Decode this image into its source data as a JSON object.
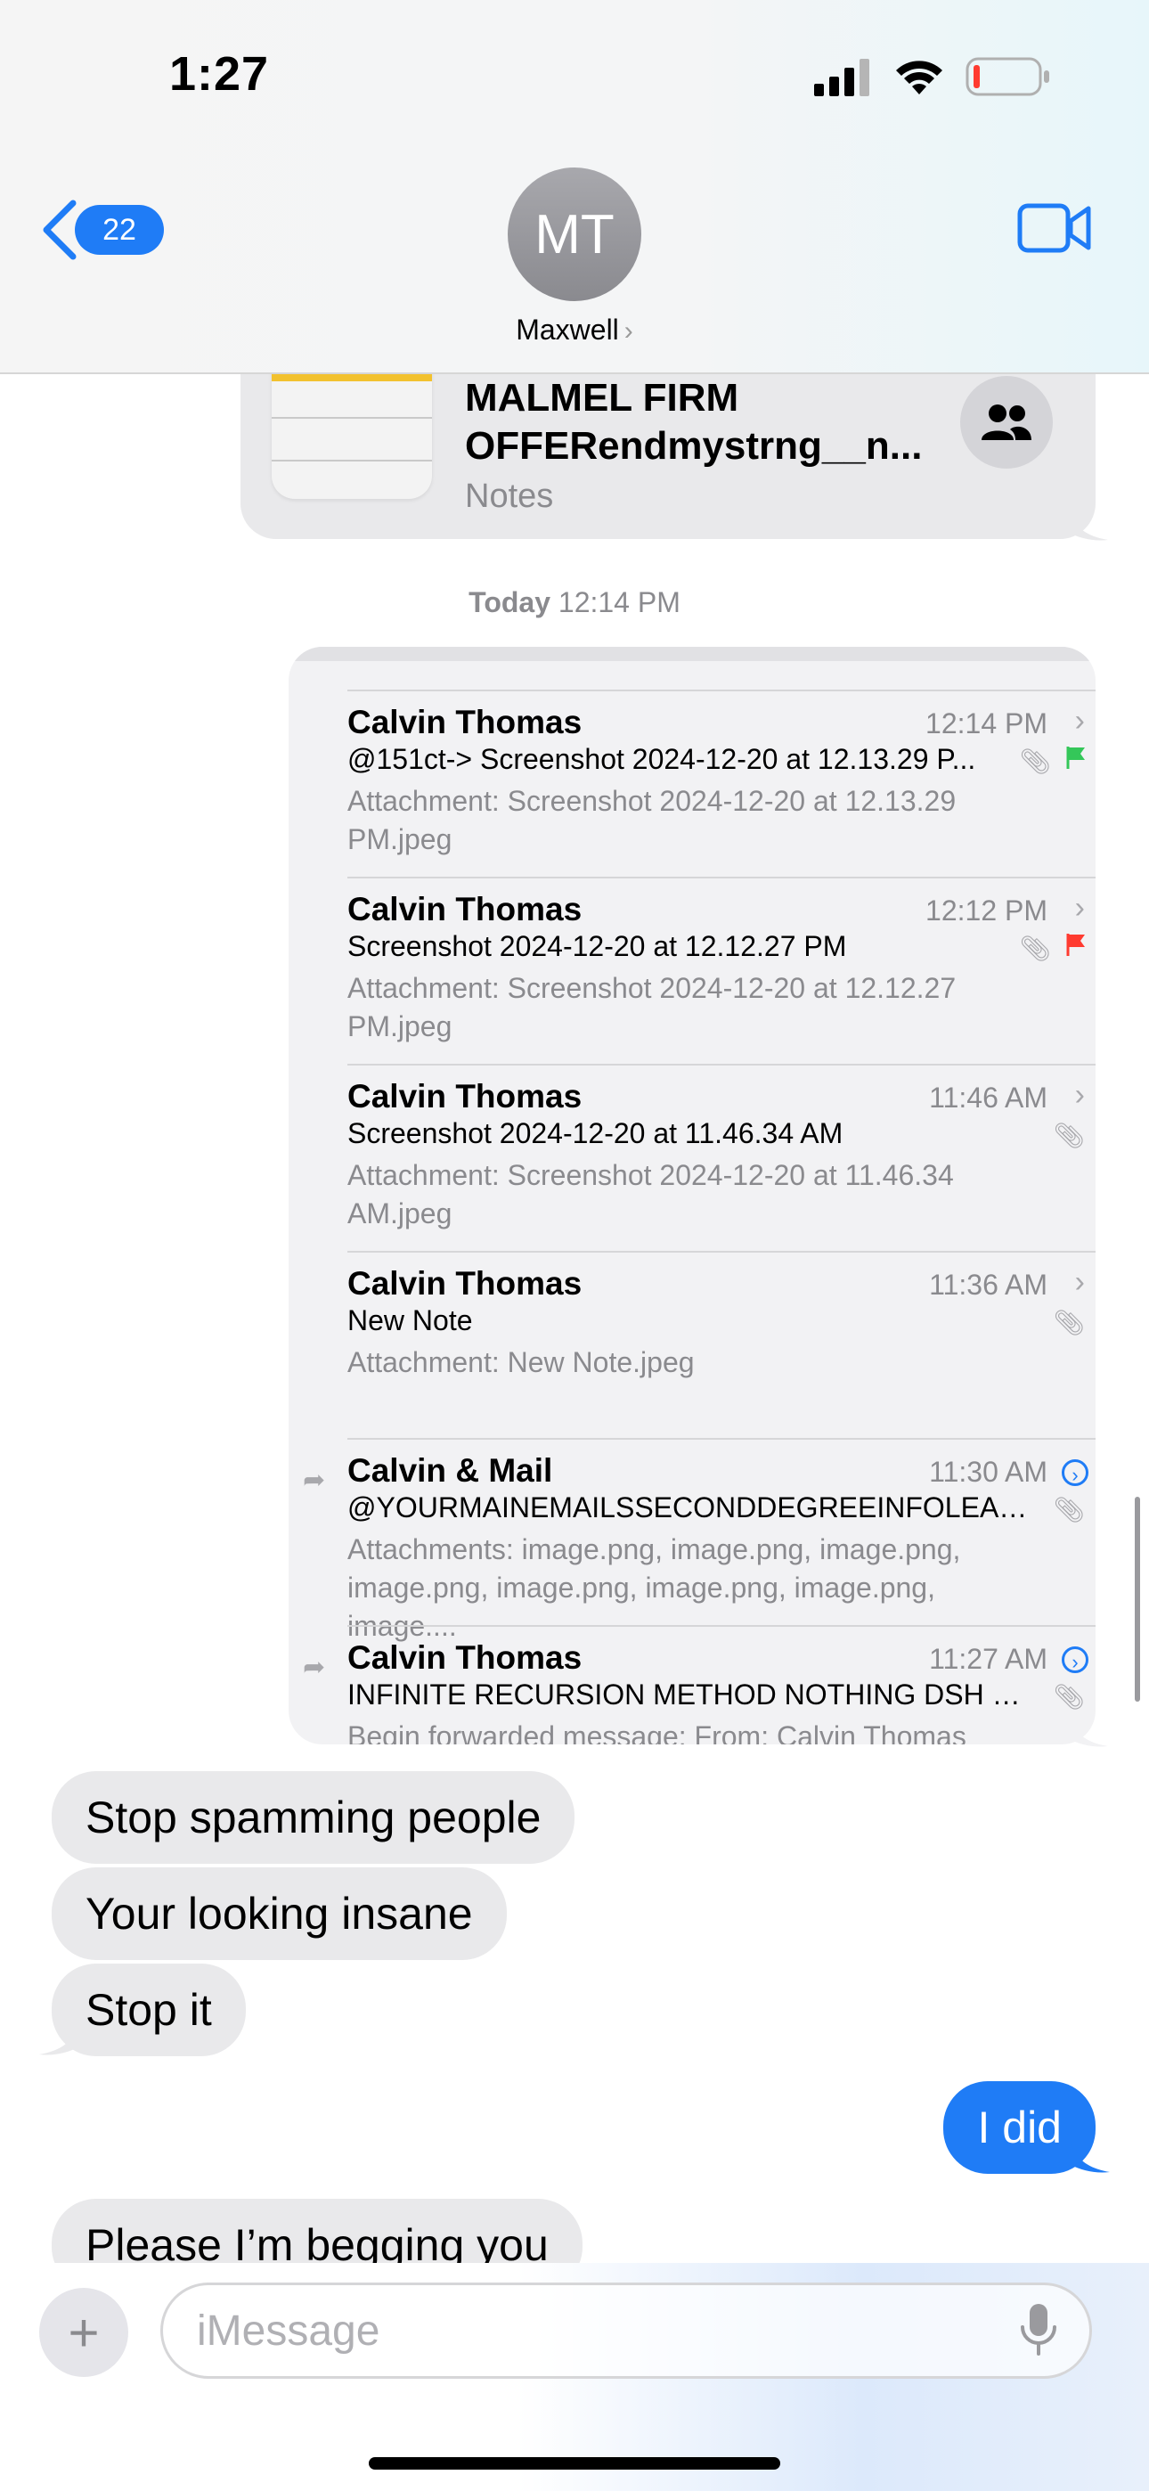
{
  "status_bar": {
    "time": "1:27"
  },
  "header": {
    "back_count": "22",
    "avatar_initials": "MT",
    "contact_name": "Maxwell"
  },
  "notes_card": {
    "title": "MALMEL FIRM OFFERendmystrng__n...",
    "app": "Notes"
  },
  "timestamp": {
    "day": "Today",
    "time": "12:14 PM"
  },
  "mail_items": [
    {
      "sender": "Calvin Thomas",
      "time": "12:14 PM",
      "subject": "@151ct-> Screenshot 2024-12-20 at 12.13.29 P...",
      "preview": "Attachment: Screenshot 2024-12-20 at 12.13.29 PM.jpeg",
      "flag_color": "#34c759"
    },
    {
      "sender": "Calvin Thomas",
      "time": "12:12 PM",
      "subject": "Screenshot 2024-12-20 at 12.12.27 PM",
      "preview": "Attachment: Screenshot 2024-12-20 at 12.12.27 PM.jpeg",
      "flag_color": "#ff3b30"
    },
    {
      "sender": "Calvin Thomas",
      "time": "11:46 AM",
      "subject": "Screenshot 2024-12-20 at 11.46.34 AM",
      "preview": "Attachment: Screenshot 2024-12-20 at 11.46.34 AM.jpeg"
    },
    {
      "sender": "Calvin Thomas",
      "time": "11:36 AM",
      "subject": "New Note",
      "preview": "Attachment: New Note.jpeg"
    },
    {
      "sender": "Calvin & Mail",
      "time": "11:30 AM",
      "subject": "@YOURMAINEMAILSSECONDDEGREEINFOLEAKR...",
      "preview": "Attachments: image.png, image.png, image.png, image.png, image.png, image.png, image.png, image...."
    },
    {
      "sender": "Calvin Thomas",
      "time": "11:27 AM",
      "subject": "INFINITE RECURSION METHOD NOTHING DSH EL...",
      "preview": "Begin forwarded message: From: Calvin Thomas"
    }
  ],
  "messages": [
    {
      "direction": "in",
      "text": "Stop spamming people"
    },
    {
      "direction": "in",
      "text": "Your looking insane"
    },
    {
      "direction": "in",
      "text": "Stop it"
    },
    {
      "direction": "out",
      "text": "I did"
    },
    {
      "direction": "in",
      "text": "Please I’m begging you"
    }
  ],
  "composer": {
    "placeholder": "iMessage"
  },
  "colors": {
    "accent": "#1f7cf6",
    "bubble_in": "#e9e9eb"
  }
}
